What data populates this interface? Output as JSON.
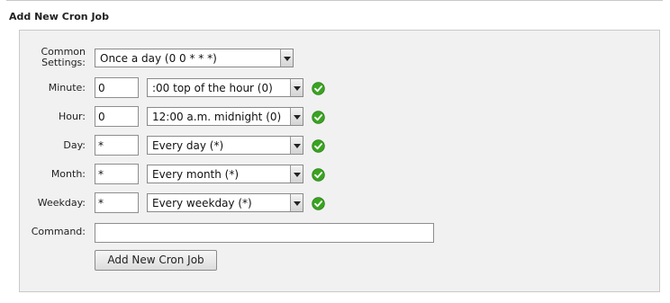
{
  "section_title": "Add New Cron Job",
  "form": {
    "common_settings": {
      "label_line1": "Common",
      "label_line2": "Settings:",
      "selected": "Once a day (0 0 * * *)"
    },
    "minute": {
      "label": "Minute:",
      "value": "0",
      "selected": ":00 top of the hour (0)",
      "valid": true
    },
    "hour": {
      "label": "Hour:",
      "value": "0",
      "selected": "12:00 a.m. midnight (0)",
      "valid": true
    },
    "day": {
      "label": "Day:",
      "value": "*",
      "selected": "Every day (*)",
      "valid": true
    },
    "month": {
      "label": "Month:",
      "value": "*",
      "selected": "Every month (*)",
      "valid": true
    },
    "weekday": {
      "label": "Weekday:",
      "value": "*",
      "selected": "Every weekday (*)",
      "valid": true
    },
    "command": {
      "label": "Command:",
      "value": ""
    },
    "submit_label": "Add New Cron Job"
  },
  "icons": {
    "valid": "green-checkmark-icon",
    "dropdown": "chevron-down-icon"
  },
  "colors": {
    "panel_background": "#f1f1f1",
    "panel_border": "#c9c9c9",
    "valid_green": "#3aa321"
  }
}
